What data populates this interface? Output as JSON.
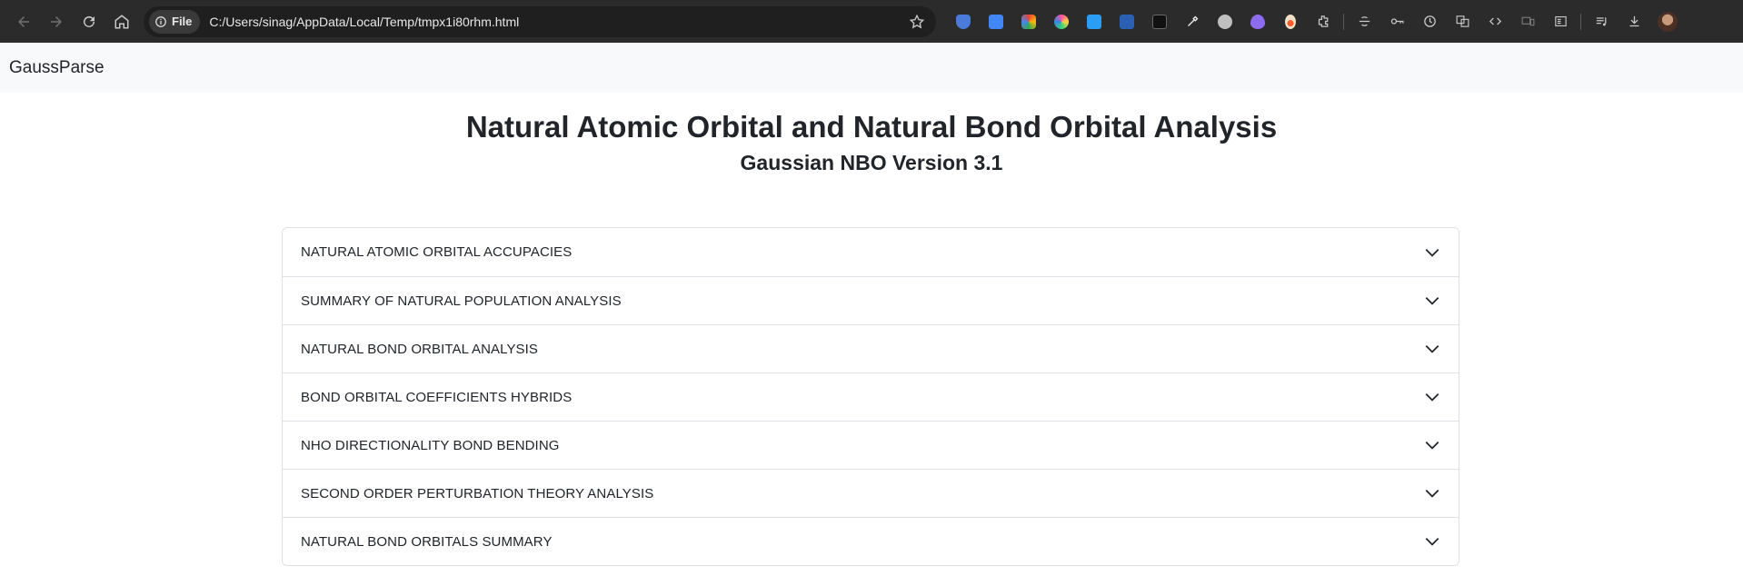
{
  "browser": {
    "chip_label": "File",
    "url": "C:/Users/sinag/AppData/Local/Temp/tmpx1i80rhm.html"
  },
  "app": {
    "brand": "GaussParse"
  },
  "header": {
    "title": "Natural Atomic Orbital and Natural Bond Orbital Analysis",
    "subtitle": "Gaussian NBO Version 3.1"
  },
  "accordion": {
    "items": [
      {
        "label": "NATURAL ATOMIC ORBITAL ACCUPACIES"
      },
      {
        "label": "SUMMARY OF NATURAL POPULATION ANALYSIS"
      },
      {
        "label": "NATURAL BOND ORBITAL ANALYSIS"
      },
      {
        "label": "BOND ORBITAL COEFFICIENTS HYBRIDS"
      },
      {
        "label": "NHO DIRECTIONALITY BOND BENDING"
      },
      {
        "label": "SECOND ORDER PERTURBATION THEORY ANALYSIS"
      },
      {
        "label": "NATURAL BOND ORBITALS SUMMARY"
      }
    ]
  },
  "colors": {
    "chrome_bg": "#2b2b2b",
    "navbar_bg": "#f8f9fa",
    "text": "#212529",
    "border": "#dee2e6"
  }
}
